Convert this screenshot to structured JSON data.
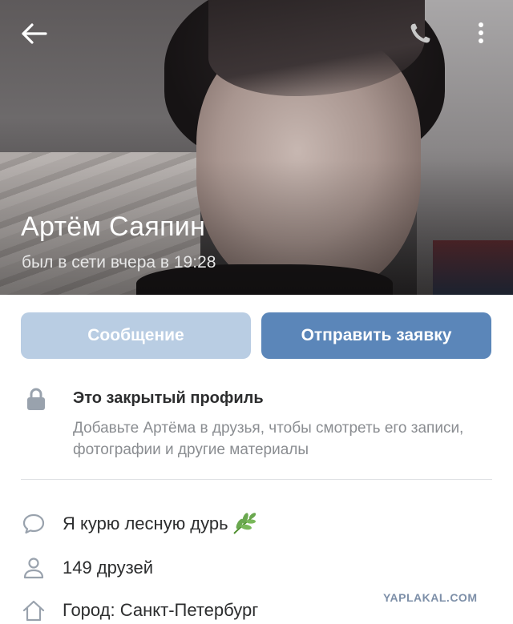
{
  "profile": {
    "name": "Артём Саяпин",
    "last_seen": "был в сети вчера в 19:28"
  },
  "topbar": {
    "back_icon": "arrow-left-icon",
    "call_icon": "phone-icon",
    "menu_icon": "more-vertical-icon"
  },
  "actions": {
    "message_label": "Сообщение",
    "friend_request_label": "Отправить заявку"
  },
  "privacy": {
    "icon": "lock-icon",
    "title": "Это закрытый профиль",
    "description": "Добавьте Артёма в друзья, чтобы смотреть его записи, фотографии и другие материалы"
  },
  "info": {
    "status": "Я курю лесную дурь",
    "status_emoji": "herb-icon",
    "friends": "149 друзей",
    "city": "Город: Санкт-Петербург"
  },
  "watermark": "YAPLAKAL.COM",
  "colors": {
    "primary_button": "#5b86b9",
    "secondary_button": "#b9cde3",
    "muted_text": "#8a8d91",
    "icon_gray": "#99a2ad"
  }
}
